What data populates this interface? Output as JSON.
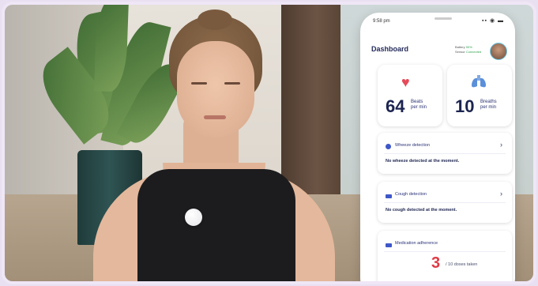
{
  "phone": {
    "status_time": "9:58 pm",
    "status_icons": "▪▪ ◉ ▬",
    "dashboard_title": "Dashboard",
    "battery_label": "Battery",
    "battery_value": "90%",
    "sensor_label": "Sensor",
    "sensor_value": "Connected"
  },
  "vitals": [
    {
      "value": "64",
      "unit_line1": "Beats",
      "unit_line2": "per min",
      "icon": "heart-icon"
    },
    {
      "value": "10",
      "unit_line1": "Breaths",
      "unit_line2": "per min",
      "icon": "lungs-icon"
    }
  ],
  "cards": {
    "wheeze": {
      "title": "Wheeze detection",
      "text": "No wheeze detected at the moment.",
      "chevron": "›"
    },
    "cough": {
      "title": "Cough detection",
      "text": "No cough detected at the moment.",
      "chevron": "›"
    },
    "medication": {
      "title": "Medication adherence",
      "count": "3",
      "label": "/ 10 doses taken"
    }
  },
  "colors": {
    "accent_navy": "#232a5a",
    "alert_red": "#e03a45",
    "heart_red": "#e54b5a",
    "lungs_blue": "#5b8fd9",
    "connected_green": "#2ea44f"
  }
}
